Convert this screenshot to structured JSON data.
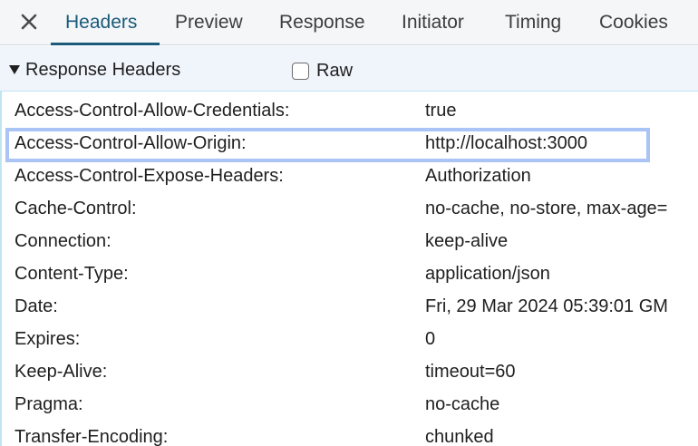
{
  "tabs": {
    "close_icon": "close-icon",
    "items": [
      {
        "label": "Headers",
        "active": true
      },
      {
        "label": "Preview"
      },
      {
        "label": "Response"
      },
      {
        "label": "Initiator"
      },
      {
        "label": "Timing"
      },
      {
        "label": "Cookies"
      }
    ]
  },
  "section": {
    "title": "Response Headers",
    "raw_label": "Raw",
    "raw_checked": false
  },
  "headers": [
    {
      "name": "Access-Control-Allow-Credentials:",
      "value": "true"
    },
    {
      "name": "Access-Control-Allow-Origin:",
      "value": "http://localhost:3000",
      "highlighted": true
    },
    {
      "name": "Access-Control-Expose-Headers:",
      "value": "Authorization"
    },
    {
      "name": "Cache-Control:",
      "value": "no-cache, no-store, max-age="
    },
    {
      "name": "Connection:",
      "value": "keep-alive"
    },
    {
      "name": "Content-Type:",
      "value": "application/json"
    },
    {
      "name": "Date:",
      "value": "Fri, 29 Mar 2024 05:39:01 GM"
    },
    {
      "name": "Expires:",
      "value": "0"
    },
    {
      "name": "Keep-Alive:",
      "value": "timeout=60"
    },
    {
      "name": "Pragma:",
      "value": "no-cache"
    },
    {
      "name": "Transfer-Encoding:",
      "value": "chunked"
    }
  ],
  "colors": {
    "active_tab": "#1a5a7a",
    "highlight_border": "#a9c4f5",
    "section_bg": "#f0f4fb"
  }
}
